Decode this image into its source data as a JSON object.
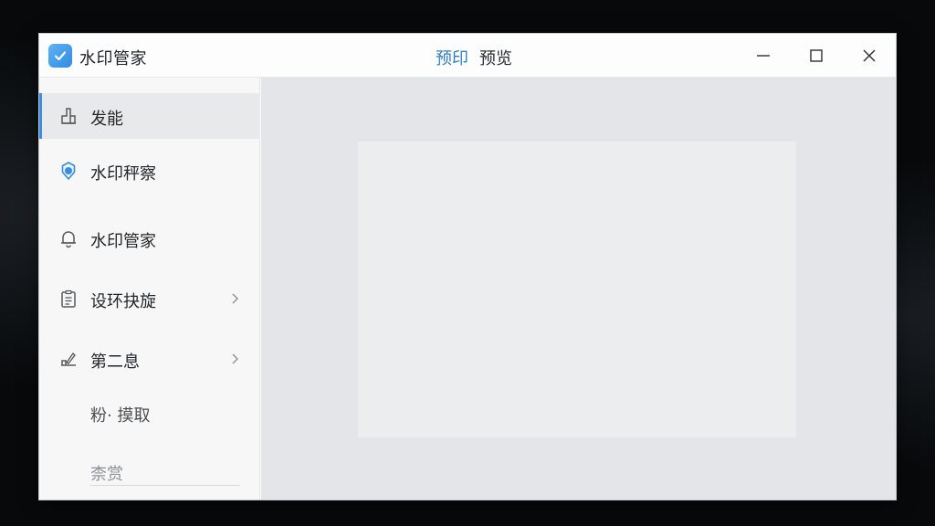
{
  "window": {
    "app_title": "水印管家",
    "tabs": [
      {
        "label": "预印",
        "active": true
      },
      {
        "label": "预览",
        "active": false
      }
    ]
  },
  "sidebar": {
    "items": [
      {
        "label": "发能",
        "icon": "document-icon",
        "active": true
      },
      {
        "label": "水印秤察",
        "icon": "gear-icon",
        "active": false
      },
      {
        "label": "水印管家",
        "icon": "bell-icon",
        "active": false
      },
      {
        "label": "设环抉旋",
        "icon": "clipboard-icon",
        "active": false,
        "has_chevron": true
      },
      {
        "label": "第二息",
        "icon": "signature-icon",
        "active": false,
        "has_chevron": true
      }
    ],
    "sub_items": [
      {
        "label": "粉· 摸取"
      },
      {
        "label": "柰赏"
      }
    ]
  },
  "colors": {
    "accent": "#3a8de0",
    "tab_active": "#2f7fc9",
    "content_bg": "#e3e5e8",
    "preview_bg": "#ebedef"
  }
}
